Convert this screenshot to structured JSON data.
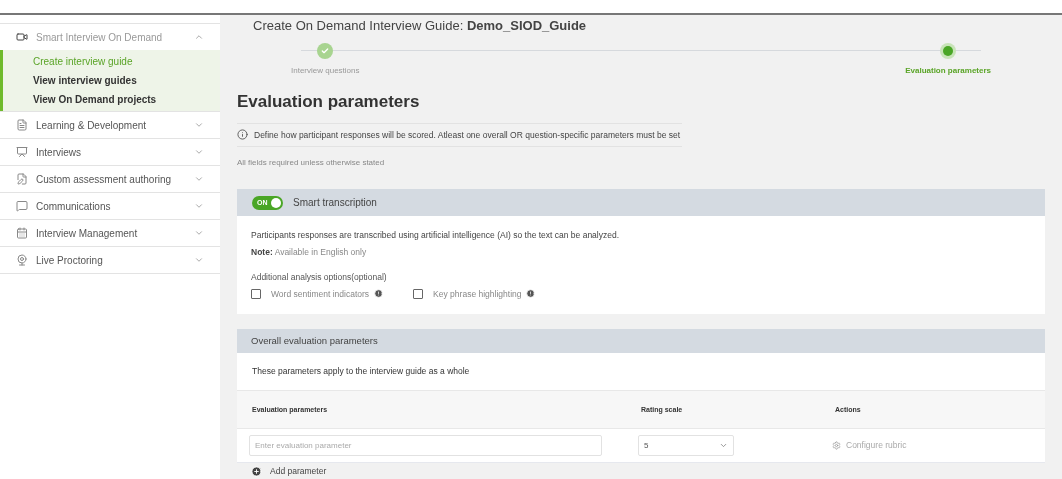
{
  "sidebar": {
    "items": [
      {
        "label": "Smart Interview On Demand",
        "expanded": true,
        "children": [
          {
            "label": "Create interview guide",
            "selected": true
          },
          {
            "label": "View interview guides",
            "selected": false
          },
          {
            "label": "View On Demand projects",
            "selected": false
          }
        ]
      },
      {
        "label": "Learning & Development",
        "expanded": false
      },
      {
        "label": "Interviews",
        "expanded": false
      },
      {
        "label": "Custom assessment authoring",
        "expanded": false
      },
      {
        "label": "Communications",
        "expanded": false
      },
      {
        "label": "Interview Management",
        "expanded": false
      },
      {
        "label": "Live Proctoring",
        "expanded": false
      }
    ]
  },
  "page_title": "Create On Demand Interview Guide: **Demo_SIOD_Guide**",
  "steps": [
    {
      "label": "Interview questions",
      "completed": true,
      "selected": false
    },
    {
      "label": "Evaluation parameters",
      "completed": false,
      "selected": true
    }
  ],
  "heading": "Evaluation parameters",
  "info": "Define how participant responses will be scored. Atleast one overall OR question-specific parameters must be set",
  "required_note": "All fields required unless otherwise stated",
  "smart_transcription": {
    "toggle": {
      "label": "ON",
      "on": true
    },
    "title": "Smart transcription",
    "description": "Participants responses are transcribed using artificial intelligence (AI) so the text can be analyzed.",
    "note": "**Note:** Available in English only",
    "options_label": "Additional analysis options(optional)",
    "options": [
      {
        "label": "Word sentiment indicators",
        "checked": false
      },
      {
        "label": "Key phrase highlighting",
        "checked": false
      }
    ]
  },
  "overall": {
    "title": "Overall evaluation parameters",
    "description": "These parameters apply to the interview guide as a whole",
    "columns": [
      "Evaluation parameters",
      "Rating scale",
      "Actions"
    ],
    "rows": [
      {
        "parameter": {
          "placeholder": "Enter evaluation parameter"
        },
        "rating_scale": "5",
        "action": "Configure rubric"
      }
    ],
    "add_button": "Add parameter"
  }
}
